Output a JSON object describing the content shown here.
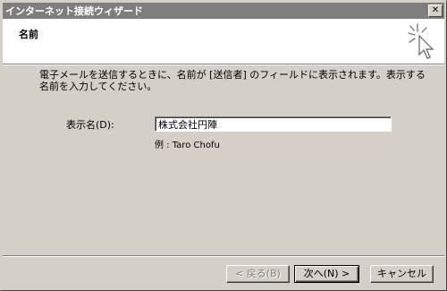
{
  "window": {
    "title": "インターネット接続ウィザード",
    "close_glyph": "✕"
  },
  "header": {
    "title": "名前",
    "icon": "wizard-sparkle-cursor-icon"
  },
  "main": {
    "description": "電子メールを送信するときに、名前が [送信者] のフィールドに表示されます。表示する名前を入力してください。",
    "name_label": "表示名(D):",
    "name_value": "株式会社円陣",
    "example": "例 : Taro Chofu"
  },
  "buttons": {
    "back": "< 戻る(B)",
    "next": "次へ(N) >",
    "cancel": "キャンセル"
  },
  "colors": {
    "titlebar": "#7e7e7e",
    "face": "#d4d0c8",
    "header_bg": "#ffffff"
  }
}
